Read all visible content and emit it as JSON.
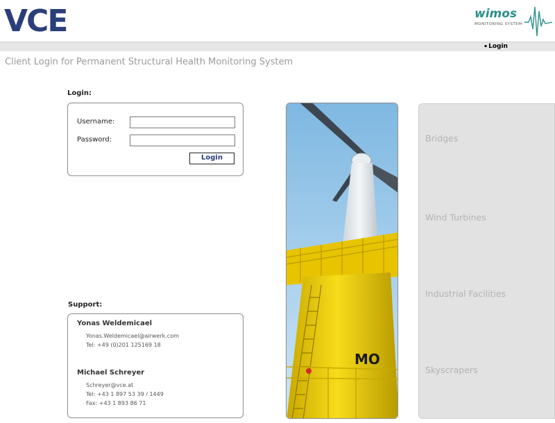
{
  "header": {
    "brand_logo": "VCE",
    "product_logo": "wimos",
    "product_tagline": "MONITORING SYSTEM"
  },
  "nav": {
    "login_link": "Login"
  },
  "page": {
    "title": "Client Login for Permanent Structural Health Monitoring System"
  },
  "login": {
    "section_label": "Login:",
    "username_label": "Username:",
    "username_value": "",
    "password_label": "Password:",
    "password_value": "",
    "submit_label": "Login"
  },
  "support": {
    "section_label": "Support:",
    "contacts": [
      {
        "name": "Yonas Weldemicael",
        "email": "Yonas.Weldemicael@airwerk.com",
        "tel": "Tel: +49 (0)201 125169 18"
      },
      {
        "name": "Michael Schreyer",
        "email": "Schreyer@vce.at",
        "tel": "Tel: +43 1 897 53 39 / 1449",
        "fax": "Fax: +43 1 893 86 71"
      }
    ]
  },
  "photo": {
    "tower_marking": "MO"
  },
  "categories": [
    "Bridges",
    "Wind Turbines",
    "Industrial Facilities",
    "Skyscrapers"
  ],
  "colors": {
    "brand_blue": "#2a3f7a",
    "wimos_teal": "#2b8f8a",
    "muted_text": "#9a9a9a",
    "panel_grey": "#e2e2e2",
    "turbine_yellow": "#f2d400"
  }
}
